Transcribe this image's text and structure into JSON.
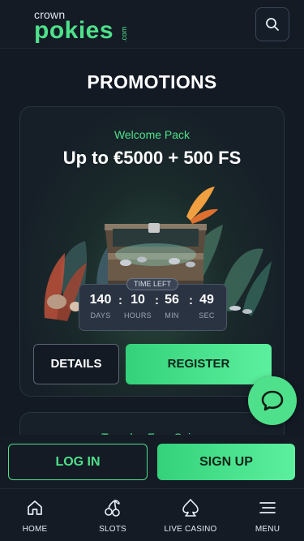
{
  "header": {
    "logo_top": "crown",
    "logo_main": "pokies",
    "logo_suffix": ".com",
    "search_icon": "search-icon"
  },
  "page": {
    "title": "PROMOTIONS"
  },
  "promo": {
    "subtitle": "Welcome Pack",
    "title": "Up to €5000 + 500 FS",
    "timer": {
      "label": "TIME LEFT",
      "days": "140",
      "days_label": "DAYS",
      "hours": "10",
      "hours_label": "HOURS",
      "min": "56",
      "min_label": "MIN",
      "sec": "49",
      "sec_label": "SEC"
    },
    "details_label": "DETAILS",
    "register_label": "REGISTER"
  },
  "promo2": {
    "subtitle": "Tuesday Free Spins"
  },
  "auth": {
    "login_label": "LOG IN",
    "signup_label": "SIGN UP"
  },
  "nav": {
    "items": [
      {
        "label": "HOME",
        "icon": "home-icon"
      },
      {
        "label": "SLOTS",
        "icon": "cherries-icon"
      },
      {
        "label": "LIVE CASINO",
        "icon": "spade-icon"
      },
      {
        "label": "MENU",
        "icon": "menu-icon"
      }
    ]
  },
  "colors": {
    "accent": "#4ee08a",
    "background": "#131a24",
    "card_border": "#2a3441"
  }
}
